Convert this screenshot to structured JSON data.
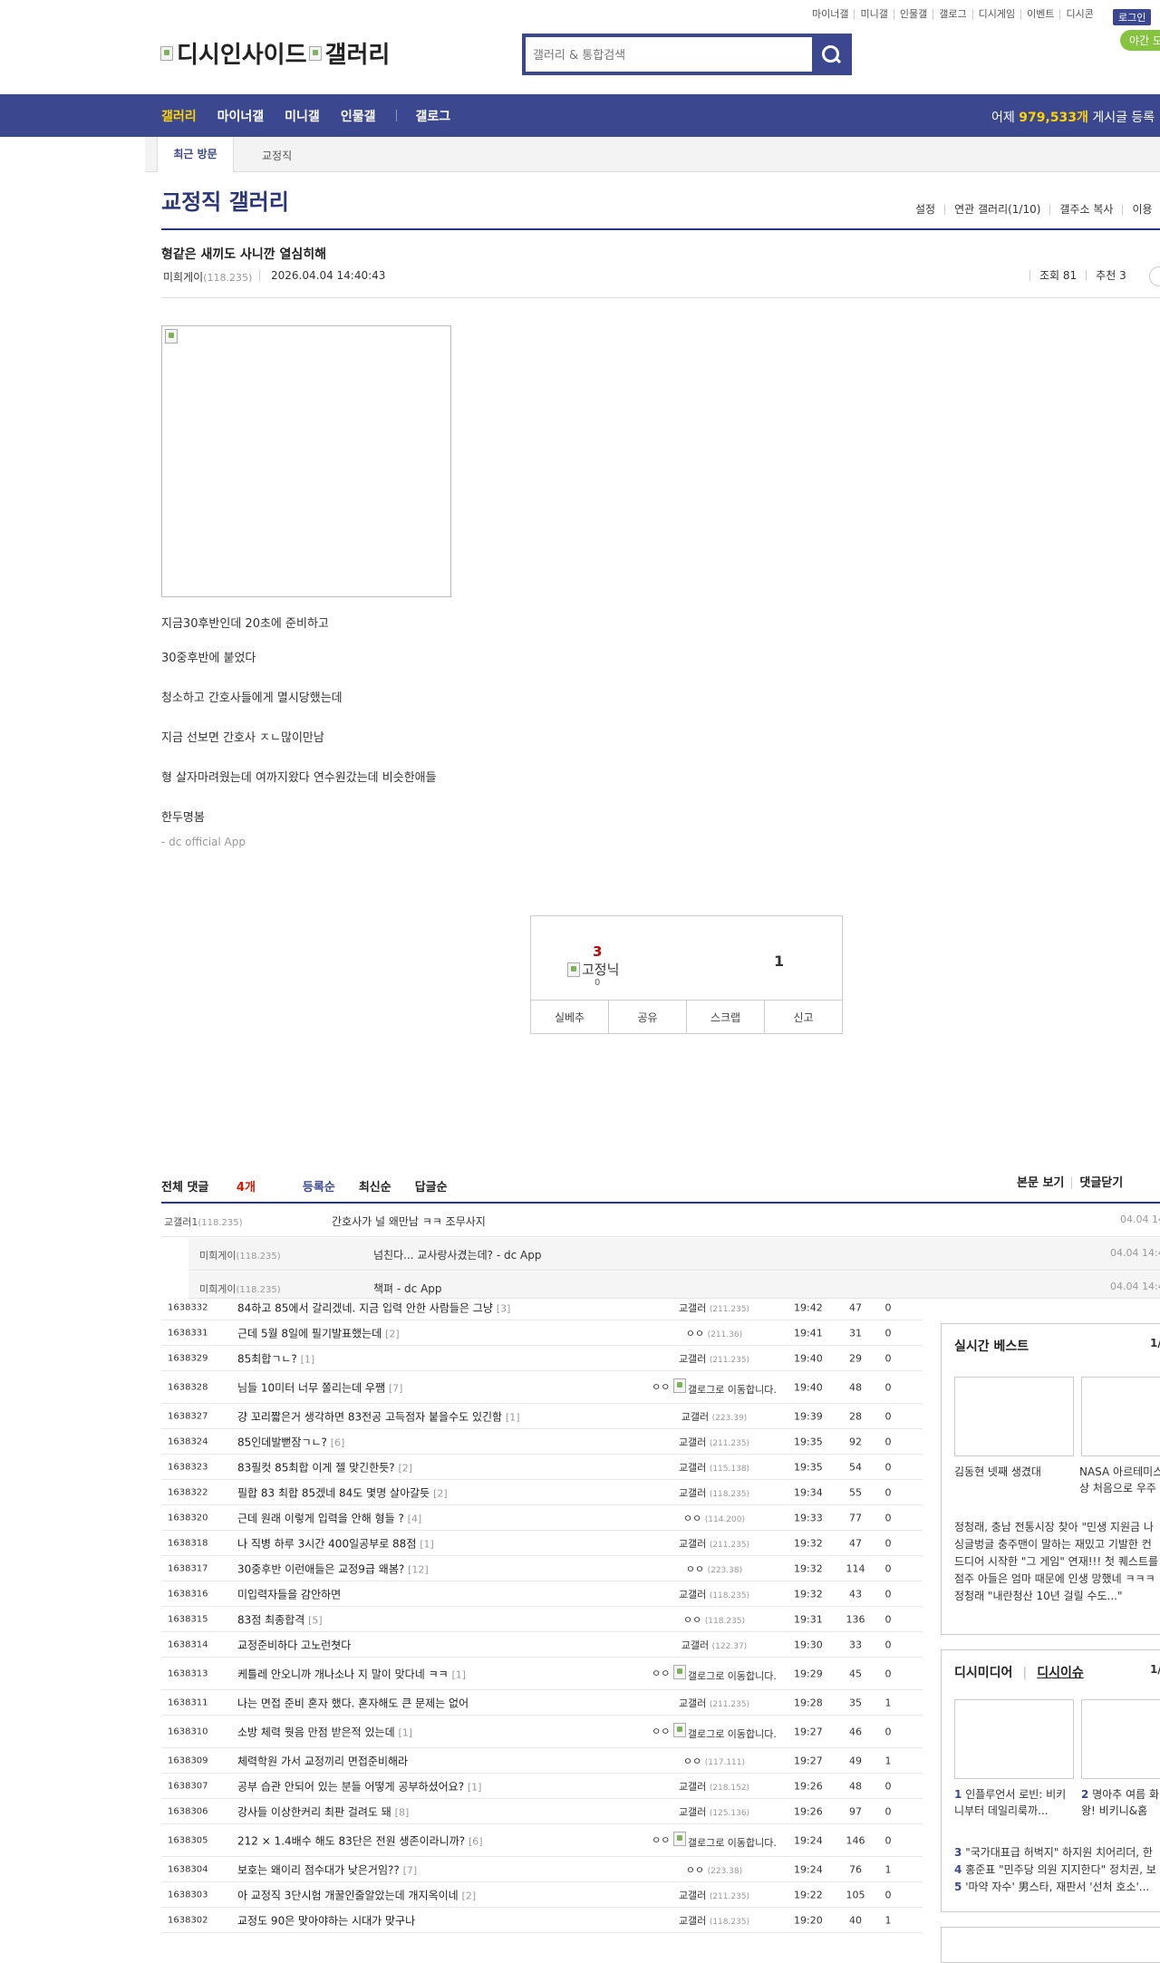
{
  "top_links": [
    "마이너갤",
    "미니갤",
    "인물갤",
    "갤로그",
    "디시게임",
    "이벤트",
    "디시콘"
  ],
  "login_label": "로그인",
  "night_mode_label": "야간 모",
  "logo": {
    "alt1": "디시인사이드",
    "alt2": "갤러리"
  },
  "search": {
    "placeholder": "갤러리 & 통합검색"
  },
  "gnb": {
    "items": [
      "갤러리",
      "마이너갤",
      "미니갤",
      "인물갤",
      "갤로그"
    ],
    "right_prefix": "어제",
    "right_count": "979,533개",
    "right_suffix": "게시글 등록"
  },
  "recent_visit": {
    "title": "최근 방문",
    "item": "교정직"
  },
  "gallery": {
    "title": "교정직 갤러리",
    "tools": [
      "설정",
      "연관 갤러리(1/10)",
      "갤주소 복사",
      "이용"
    ]
  },
  "post": {
    "title": "형같은 새끼도 사니깐 열심히해",
    "writer": "미희게이",
    "writer_ip": "(118.235)",
    "date": "2026.04.04 14:40:43",
    "views_label": "조회 81",
    "recommend_label": "추천 3",
    "image_alt": "",
    "body_lines": [
      "지금30후반인데 20초에 준비하고",
      "30중후반에 붙었다",
      "청소하고 간호사들에게 멸시당했는데",
      "지금 선보면 간호사 ㅈㄴ많이만남",
      "형 살자마려웠는데 여까지왔다 연수원갔는데 비슷한애들",
      "한두명봄"
    ],
    "app_sign": "- dc official App"
  },
  "recommend": {
    "up_count": "3",
    "up_image_alt": "고정닉",
    "up_sub": "0",
    "down_count": "1",
    "buttons": [
      "실베추",
      "공유",
      "스크랩",
      "신고"
    ]
  },
  "comments": {
    "header": {
      "total_label": "전체 댓글",
      "total_count": "4개",
      "sort": [
        "등록순",
        "최신순",
        "답글순"
      ],
      "right": [
        "본문 보기",
        "댓글닫기"
      ]
    },
    "items": [
      {
        "name": "교갤러1",
        "ip": "(118.235)",
        "text": "간호사가 널 왜만남 ㅋㅋ 조무사지",
        "date": "04.04 14",
        "reply": false
      },
      {
        "name": "미희게이",
        "ip": "(118.235)",
        "text": "넘친다... 교사랑사겼는데? - dc App",
        "date": "04.04 14:4",
        "reply": true
      },
      {
        "name": "미희게이",
        "ip": "(118.235)",
        "text": "책펴 - dc App",
        "date": "04.04 14:4",
        "reply": true
      }
    ]
  },
  "post_list": [
    {
      "num": "1638332",
      "subject": "84하고 85에서 갈리겠네. 지금 입력 안한 사람들은 그냥",
      "rc": "[3]",
      "writer": "교갤러",
      "ip": "(211.235)",
      "time": "19:42",
      "views": "47",
      "rec": "0",
      "img_writer": false
    },
    {
      "num": "1638331",
      "subject": "근데 5월 8일에 필기발표했는데",
      "rc": "[2]",
      "writer": "ㅇㅇ",
      "ip": "(211.36)",
      "time": "19:41",
      "views": "31",
      "rec": "0",
      "img_writer": false
    },
    {
      "num": "1638329",
      "subject": "85최합ㄱㄴ?",
      "rc": "[1]",
      "writer": "교갤러",
      "ip": "(211.235)",
      "time": "19:40",
      "views": "29",
      "rec": "0",
      "img_writer": false
    },
    {
      "num": "1638328",
      "subject": "님들 10미터 너무 쫄리는데 우쨈",
      "rc": "[7]",
      "writer": "ㅇㅇ",
      "ip": "",
      "time": "19:40",
      "views": "48",
      "rec": "0",
      "img_writer": true
    },
    {
      "num": "1638327",
      "subject": "걍 꼬리짧은거 생각하면 83전공 고득점자 붙을수도 있긴함",
      "rc": "[1]",
      "writer": "교갤러",
      "ip": "(223.39)",
      "time": "19:39",
      "views": "28",
      "rec": "0",
      "img_writer": false
    },
    {
      "num": "1638324",
      "subject": "85인데발뻗잠ㄱㄴ?",
      "rc": "[6]",
      "writer": "교갤러",
      "ip": "(211.235)",
      "time": "19:35",
      "views": "92",
      "rec": "0",
      "img_writer": false
    },
    {
      "num": "1638323",
      "subject": "83필컷 85최합 이게 젤 맞긴한듯?",
      "rc": "[2]",
      "writer": "교갤러",
      "ip": "(115.138)",
      "time": "19:35",
      "views": "54",
      "rec": "0",
      "img_writer": false
    },
    {
      "num": "1638322",
      "subject": "필합 83 최합 85겠네 84도 몇명 살아갈듯",
      "rc": "[2]",
      "writer": "교갤러",
      "ip": "(118.235)",
      "time": "19:34",
      "views": "55",
      "rec": "0",
      "img_writer": false
    },
    {
      "num": "1638320",
      "subject": "근데 원래 이렇게 입력을 안해 형들 ?",
      "rc": "[4]",
      "writer": "ㅇㅇ",
      "ip": "(114.200)",
      "time": "19:33",
      "views": "77",
      "rec": "0",
      "img_writer": false
    },
    {
      "num": "1638318",
      "subject": "나 직병 하루 3시간 400일공부로 88점",
      "rc": "[1]",
      "writer": "교갤러",
      "ip": "(211.235)",
      "time": "19:32",
      "views": "47",
      "rec": "0",
      "img_writer": false
    },
    {
      "num": "1638317",
      "subject": "30중후반 이런애들은 교정9급 왜봄?",
      "rc": "[12]",
      "writer": "ㅇㅇ",
      "ip": "(223.38)",
      "time": "19:32",
      "views": "114",
      "rec": "0",
      "img_writer": false
    },
    {
      "num": "1638316",
      "subject": "미입력자들을 감안하면",
      "rc": "",
      "writer": "교갤러",
      "ip": "(118.235)",
      "time": "19:32",
      "views": "43",
      "rec": "0",
      "img_writer": false
    },
    {
      "num": "1638315",
      "subject": "83점 최종합격",
      "rc": "[5]",
      "writer": "ㅇㅇ",
      "ip": "(118.235)",
      "time": "19:31",
      "views": "136",
      "rec": "0",
      "img_writer": false
    },
    {
      "num": "1638314",
      "subject": "교정준비하다 고노런쳣다",
      "rc": "",
      "writer": "교갤러",
      "ip": "(122.37)",
      "time": "19:30",
      "views": "33",
      "rec": "0",
      "img_writer": false
    },
    {
      "num": "1638313",
      "subject": "케틀레 안오니까 개나소나 지 말이 맞다네 ㅋㅋ",
      "rc": "[1]",
      "writer": "ㅇㅇ",
      "ip": "",
      "time": "19:29",
      "views": "45",
      "rec": "0",
      "img_writer": true
    },
    {
      "num": "1638311",
      "subject": "나는 면접 준비 혼자 했다. 혼자해도 큰 문제는 없어",
      "rc": "",
      "writer": "교갤러",
      "ip": "(211.235)",
      "time": "19:28",
      "views": "35",
      "rec": "1",
      "img_writer": false
    },
    {
      "num": "1638310",
      "subject": "소방 체력 뭣음 만점 받은적 있는데",
      "rc": "[1]",
      "writer": "ㅇㅇ",
      "ip": "",
      "time": "19:27",
      "views": "46",
      "rec": "0",
      "img_writer": true
    },
    {
      "num": "1638309",
      "subject": "체력학원 가서 교정끼리 면접준비해라",
      "rc": "",
      "writer": "ㅇㅇ",
      "ip": "(117.111)",
      "time": "19:27",
      "views": "49",
      "rec": "1",
      "img_writer": false
    },
    {
      "num": "1638307",
      "subject": "공부 습관 안되어 있는 분들 어떻게 공부하셨어요?",
      "rc": "[1]",
      "writer": "교갤러",
      "ip": "(218.152)",
      "time": "19:26",
      "views": "48",
      "rec": "0",
      "img_writer": false
    },
    {
      "num": "1638306",
      "subject": "강사들 이상한커리 최판 걸려도 돼",
      "rc": "[8]",
      "writer": "교갤러",
      "ip": "(125.136)",
      "time": "19:26",
      "views": "97",
      "rec": "0",
      "img_writer": false
    },
    {
      "num": "1638305",
      "subject": "212 × 1.4배수 해도 83단은 전원 생존이라니까?",
      "rc": "[6]",
      "writer": "ㅇㅇ",
      "ip": "",
      "time": "19:24",
      "views": "146",
      "rec": "0",
      "img_writer": true
    },
    {
      "num": "1638304",
      "subject": "보호는 왜이리 점수대가 낮은거임??",
      "rc": "[7]",
      "writer": "ㅇㅇ",
      "ip": "(223.38)",
      "time": "19:24",
      "views": "76",
      "rec": "1",
      "img_writer": false
    },
    {
      "num": "1638303",
      "subject": "아 교정직 3단시험 개꿀인줄알았는데 개지옥이네",
      "rc": "[2]",
      "writer": "교갤러",
      "ip": "(211.235)",
      "time": "19:22",
      "views": "105",
      "rec": "0",
      "img_writer": false
    },
    {
      "num": "1638302",
      "subject": "교정도 90은 맞아야하는 시대가 맞구나",
      "rc": "",
      "writer": "교갤러",
      "ip": "(118.235)",
      "time": "19:20",
      "views": "40",
      "rec": "1",
      "img_writer": false
    }
  ],
  "img_writer_label": "갤로그로 이동합니다.",
  "sidebar": {
    "best": {
      "title": "실시간 베스트",
      "page": "1/",
      "thumbs": [
        {
          "caption": "김동현 넷째 생겼대"
        },
        {
          "caption": "NASA 아르테미스 상 처음으로 우주"
        }
      ],
      "list": [
        "정청래, 충남 전통시장 찾아 \"민생 지원금 나",
        "싱글벙글 충주맨이 말하는 재밌고 기발한 컨",
        "드디어 시작한 \"그 게임\" 연재!!! 첫 퀘스트를",
        "점주 아들은 엄마 때문에 인생 망했네 ㅋㅋㅋ",
        "정청래 \"내란청산 10년 걸릴 수도...\""
      ]
    },
    "media": {
      "title1": "디시미디어",
      "title2": "디시이슈",
      "page": "1/",
      "thumbs": [
        {
          "num": "1",
          "caption": "인플루언서 로빈: 비키니부터 데일리룩까..."
        },
        {
          "num": "2",
          "caption": "명아추 여름 화 왕! 비키니&홈"
        }
      ],
      "list": [
        {
          "num": "3",
          "text": "\"국가대표급 허벅지\" 하지원 치어리더, 한"
        },
        {
          "num": "4",
          "text": "홍준표 \"민주당 의원 지지한다\" 정치권, 보"
        },
        {
          "num": "5",
          "text": "'마약 자수' 男스타, 재판서 '선처 호소'..."
        }
      ]
    }
  }
}
